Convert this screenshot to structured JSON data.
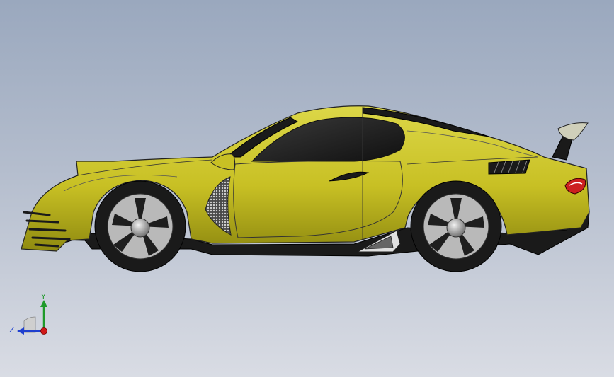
{
  "viewport": {
    "background_top": "#9aa8be",
    "background_bottom": "#d9dce4"
  },
  "model": {
    "body_color": "#c8c024",
    "body_highlight": "#dcd748",
    "body_shadow": "#8f8a10",
    "glass_color": "#1e1e1e",
    "trim_color": "#1a1a1a",
    "rim_color": "#b9b9b9",
    "taillight_color": "#cc1f1f"
  },
  "triad": {
    "y_label": "Y",
    "z_label": "Z",
    "y_color": "#1f9a2a",
    "z_color": "#1f3fcf",
    "x_color": "#d01818"
  }
}
